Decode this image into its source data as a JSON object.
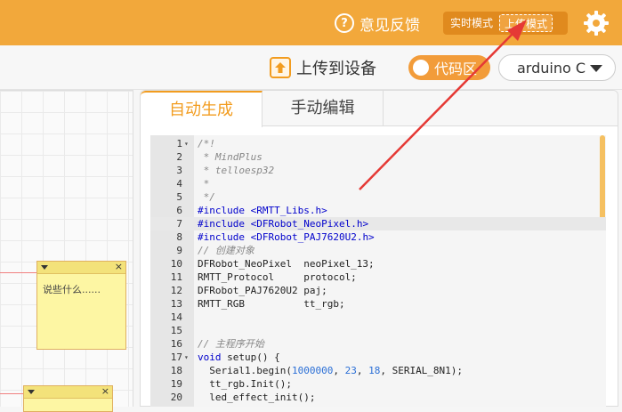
{
  "topbar": {
    "feedback_label": "意见反馈",
    "realtime_mode_label": "实时模式",
    "upload_mode_label": "上传模式"
  },
  "toolbar": {
    "upload_label": "上传到设备",
    "code_toggle_label": "代码区",
    "board_selected": "arduino C"
  },
  "workspace": {
    "note_text": "说些什么......"
  },
  "editor": {
    "tabs": [
      "自动生成",
      "手动编辑"
    ],
    "lines": [
      {
        "n": "1",
        "fold": true,
        "segs": [
          [
            "cm",
            "/*!"
          ]
        ]
      },
      {
        "n": "2",
        "segs": [
          [
            "cm",
            " * MindPlus"
          ]
        ]
      },
      {
        "n": "3",
        "segs": [
          [
            "cm",
            " * telloesp32"
          ]
        ]
      },
      {
        "n": "4",
        "segs": [
          [
            "cm",
            " *"
          ]
        ]
      },
      {
        "n": "5",
        "segs": [
          [
            "cm",
            " */"
          ]
        ]
      },
      {
        "n": "6",
        "segs": [
          [
            "kw",
            "#include "
          ],
          [
            "str",
            "<RMTT_Libs.h>"
          ]
        ]
      },
      {
        "n": "7",
        "active": true,
        "segs": [
          [
            "kw",
            "#include "
          ],
          [
            "str",
            "<DFRobot_NeoPixel.h>"
          ]
        ]
      },
      {
        "n": "8",
        "segs": [
          [
            "kw",
            "#include "
          ],
          [
            "str",
            "<DFRobot_PAJ7620U2.h>"
          ]
        ]
      },
      {
        "n": "9",
        "segs": [
          [
            "cm",
            "// 创建对象"
          ]
        ]
      },
      {
        "n": "10",
        "segs": [
          [
            "txt",
            "DFRobot_NeoPixel  neoPixel_13;"
          ]
        ]
      },
      {
        "n": "11",
        "segs": [
          [
            "txt",
            "RMTT_Protocol     protocol;"
          ]
        ]
      },
      {
        "n": "12",
        "segs": [
          [
            "txt",
            "DFRobot_PAJ7620U2 paj;"
          ]
        ]
      },
      {
        "n": "13",
        "segs": [
          [
            "txt",
            "RMTT_RGB          tt_rgb;"
          ]
        ]
      },
      {
        "n": "14",
        "segs": []
      },
      {
        "n": "15",
        "segs": []
      },
      {
        "n": "16",
        "segs": [
          [
            "cm",
            "// 主程序开始"
          ]
        ]
      },
      {
        "n": "17",
        "fold": true,
        "segs": [
          [
            "kw",
            "void"
          ],
          [
            "txt",
            " setup() {"
          ]
        ]
      },
      {
        "n": "18",
        "segs": [
          [
            "txt",
            "  Serial1.begin("
          ],
          [
            "num",
            "1000000"
          ],
          [
            "txt",
            ", "
          ],
          [
            "num",
            "23"
          ],
          [
            "txt",
            ", "
          ],
          [
            "num",
            "18"
          ],
          [
            "txt",
            ", SERIAL_8N1);"
          ]
        ]
      },
      {
        "n": "19",
        "segs": [
          [
            "txt",
            "  tt_rgb.Init();"
          ]
        ]
      },
      {
        "n": "20",
        "segs": [
          [
            "txt",
            "  led_effect_init();"
          ]
        ]
      }
    ]
  },
  "colors": {
    "accent": "#f2a83b",
    "arrow": "#e53935",
    "keyword": "#0000cc",
    "comment": "#888888"
  }
}
